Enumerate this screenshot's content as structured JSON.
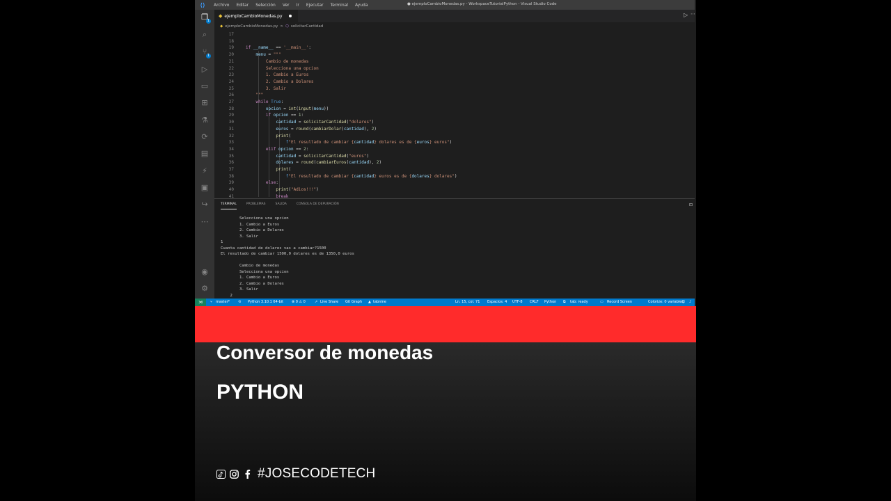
{
  "titlebar": {
    "menu": [
      "Archivo",
      "Editar",
      "Selección",
      "Ver",
      "Ir",
      "Ejecutar",
      "Terminal",
      "Ayuda"
    ],
    "window_title": "● ejemploCambioMonedas.py - WorkspaceTutorialPython - Visual Studio Code"
  },
  "tab": {
    "label": "ejemploCambioMonedas.py"
  },
  "breadcrumb": {
    "file": "ejemploCambioMonedas.py",
    "separator": ">",
    "symbol": "solicitarCantidad"
  },
  "editor": {
    "line_numbers": [
      "17",
      "18",
      "19",
      "20",
      "21",
      "22",
      "23",
      "24",
      "25",
      "26",
      "27",
      "28",
      "29",
      "30",
      "31",
      "32",
      "33",
      "34",
      "35",
      "36",
      "37",
      "38",
      "39",
      "40",
      "41"
    ]
  },
  "panel": {
    "tabs": [
      "TERMINAL",
      "PROBLEMAS",
      "SALIDA",
      "CONSOLA DE DEPURACIÓN"
    ],
    "terminal_lines": [
      "        Selecciona una opcion",
      "        1. Cambio a Euros",
      "        2. Cambio a Dolares",
      "        3. Salir",
      "",
      "1",
      "Cuanta cantidad de dolares vas a cambiar?1500",
      "El resultado de cambiar 1500,0 dolares es de 1350,0 euros",
      "",
      "        Cambio de monedas",
      "        Selecciona una opcion",
      "        1. Cambio a Euros",
      "        2. Cambio a Dolares",
      "        3. Salir",
      "    2"
    ]
  },
  "statusbar": {
    "branch": "master*",
    "python": "Python 3.10.1 64-bit",
    "problems": "⊗ 0 ⚠ 0",
    "live_share": "Live Share",
    "git_graph": "Git Graph",
    "tabnine": "tabnine",
    "position": "Ln. 15, col. 71",
    "spaces": "Espacios: 4",
    "encoding": "UTF-8",
    "eol": "CRLF",
    "language": "Python",
    "tab_ready": "tab: ready",
    "record": "Record Screen",
    "colorize": "Colorize: 0 variables"
  },
  "overlay": {
    "title": "Conversor de monedas",
    "subtitle": "PYTHON",
    "hashtag": "#JOSECODETECH",
    "icons": [
      "tiktok-icon",
      "instagram-icon",
      "facebook-icon"
    ]
  },
  "colors": {
    "band": "#ff2b2b",
    "vscode_blue": "#007acc",
    "text_white": "#ffffff"
  }
}
